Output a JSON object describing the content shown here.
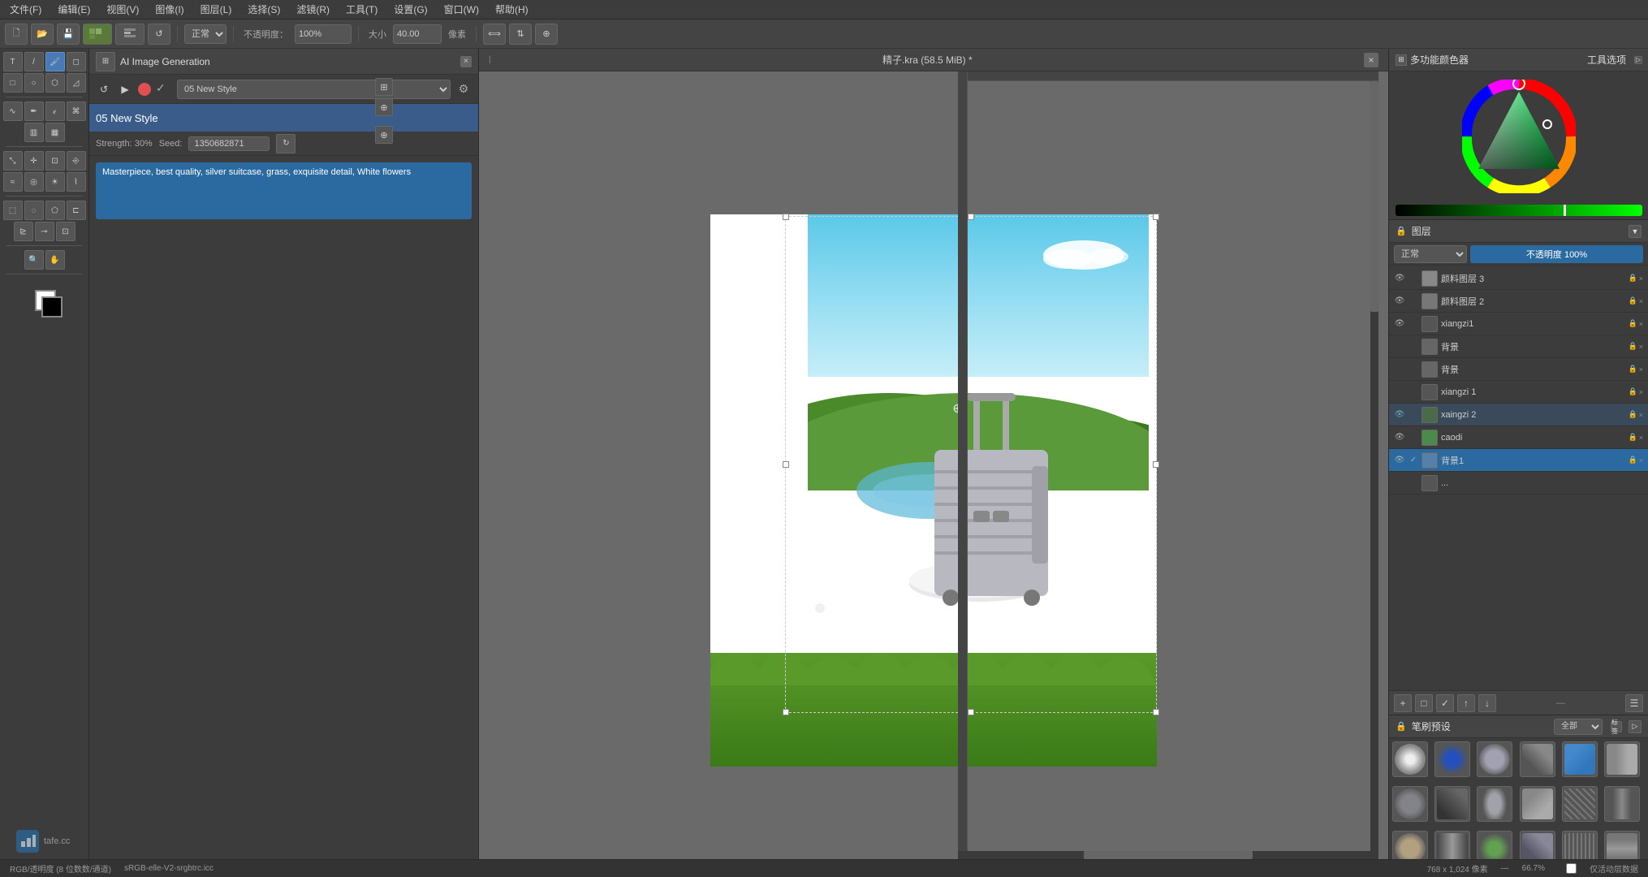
{
  "app": {
    "title": "精子.kra (58.5 MiB) *",
    "watermark": "tafe.cc"
  },
  "menu": {
    "items": [
      "文件(F)",
      "编辑(E)",
      "视图(V)",
      "图像(I)",
      "图层(L)",
      "选择(S)",
      "滤镜(R)",
      "工具(T)",
      "设置(G)",
      "窗口(W)",
      "帮助(H)"
    ]
  },
  "toolbar": {
    "opacity_label": "不透明度：",
    "opacity_value": "100%",
    "size_label": "大小",
    "size_value": "40.00",
    "unit": "像素",
    "blend_mode": "正常"
  },
  "ai_panel": {
    "title": "AI Image Generation",
    "close": "×",
    "style_label": "05 New Style",
    "strength_label": "Strength: 30%",
    "seed_label": "Seed:",
    "seed_value": "1350682871",
    "prompt": "Masterpiece, best quality, silver suitcase, grass, exquisite detail, White flowers"
  },
  "layers": {
    "blend_mode": "正常",
    "opacity_label": "不透明度 100%",
    "panel_title": "图层",
    "items": [
      {
        "name": "颜料图层 3",
        "visible": true,
        "active": false
      },
      {
        "name": "颜料图层 2",
        "visible": true,
        "active": false
      },
      {
        "name": "xiangzi1",
        "visible": true,
        "active": false
      },
      {
        "name": "背景",
        "visible": true,
        "active": false
      },
      {
        "name": "背景",
        "visible": true,
        "active": false
      },
      {
        "name": "xiangzi 1",
        "visible": true,
        "active": false
      },
      {
        "name": "xaingzi 2",
        "visible": true,
        "active": false
      },
      {
        "name": "caodi",
        "visible": true,
        "active": false
      },
      {
        "name": "背景1",
        "visible": true,
        "active": true
      },
      {
        "name": "...",
        "visible": false,
        "active": false
      }
    ]
  },
  "brushes": {
    "panel_title": "笔刷预设",
    "filter_label": "全部",
    "view_label": "标签"
  },
  "status": {
    "color_mode": "RGB/透明度 (8 位数数/通道)",
    "profile": "sRGB-elle-V2-srgbtrc.icc",
    "dimensions": "768 x 1,024 像素",
    "zoom": "66.7%",
    "checkbox_label": "仅活动层数据"
  },
  "color_panel": {
    "title": "多功能颜色器",
    "tool_title": "工具选项"
  }
}
